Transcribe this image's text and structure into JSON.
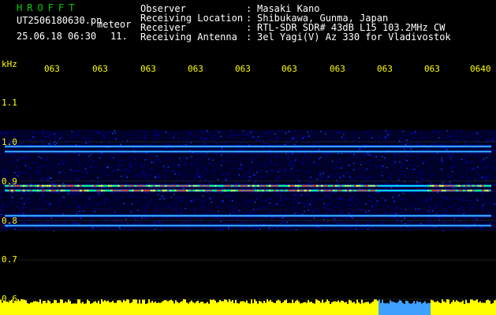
{
  "header": {
    "app_title": "HROFFT",
    "file_name": "UT2506180630.pn",
    "file_kind": "meteor",
    "datetime": "25.06.18 06:30",
    "count": "11.",
    "meta": [
      {
        "label": "Observer",
        "value": "Masaki Kano"
      },
      {
        "label": "Receiving Location",
        "value": "Shibukawa, Gunma, Japan"
      },
      {
        "label": "Receiver",
        "value": "RTL-SDR SDR# 43dB L15 103.2MHz CW"
      },
      {
        "label": "Receiving Antenna",
        "value": "3el Yagi(V) Az 330 for Vladivostok"
      }
    ]
  },
  "chart_data": {
    "type": "heatmap",
    "ylabel": "kHz",
    "x_ticks": [
      "063",
      "063",
      "063",
      "063",
      "063",
      "063",
      "063",
      "063",
      "063",
      "0640"
    ],
    "y_ticks": [
      "1.1",
      "1.0",
      "0.9",
      "0.8",
      "0.7",
      "0.6"
    ],
    "ylim": [
      0.6,
      1.1
    ],
    "bands": [
      {
        "freq": 0.988,
        "strength": 0.45
      },
      {
        "freq": 0.975,
        "strength": 0.25
      },
      {
        "freq": 0.888,
        "strength": 0.9
      },
      {
        "freq": 0.876,
        "strength": 0.7
      },
      {
        "freq": 0.812,
        "strength": 0.35
      },
      {
        "freq": 0.787,
        "strength": 0.45
      }
    ],
    "colors": {
      "background": "#000000",
      "noise": "#0000aa",
      "signal": "#ff2000",
      "axis": "#ffff00",
      "bar": "#ffff00"
    }
  }
}
